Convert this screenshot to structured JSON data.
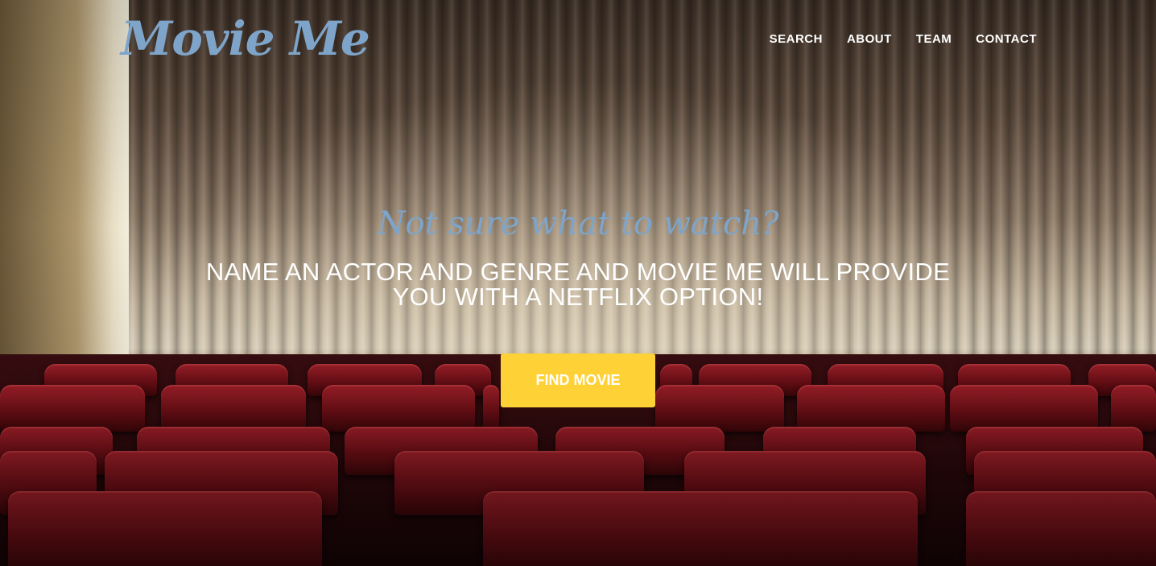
{
  "brand": {
    "name": "Movie Me"
  },
  "nav": {
    "items": [
      "SEARCH",
      "ABOUT",
      "TEAM",
      "CONTACT"
    ]
  },
  "hero": {
    "subheading": "Not sure what to watch?",
    "heading": "NAME AN ACTOR AND GENRE AND MOVIE ME WILL PROVIDE YOU WITH A NETFLIX OPTION!",
    "cta_label": "FIND MOVIE",
    "background_image": "theater-curtain-red-seats"
  },
  "colors": {
    "accent_blue": "#7ea4c9",
    "cta_yellow": "#fed136",
    "text_white": "#ffffff"
  }
}
